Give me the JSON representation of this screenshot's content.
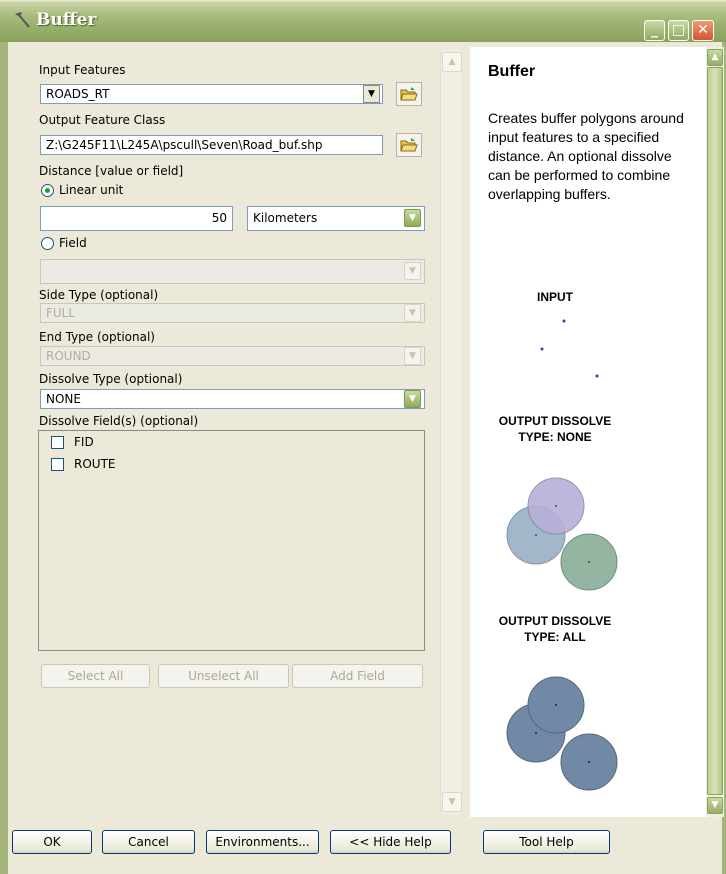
{
  "window": {
    "title": "Buffer",
    "icon": "hammer-icon",
    "controls": [
      "minimize",
      "maximize",
      "close"
    ],
    "accent_color": "#97ad6a"
  },
  "form": {
    "input_features": {
      "label": "Input Features",
      "value": "ROADS_RT"
    },
    "output_feature_class": {
      "label": "Output Feature Class",
      "value": "Z:\\G245F11\\L245A\\pscull\\Seven\\Road_buf.shp"
    },
    "distance": {
      "label": "Distance [value or field]",
      "linear_unit_label": "Linear unit",
      "value": "50",
      "unit": "Kilometers",
      "field_label": "Field",
      "field_value": "",
      "selected": "linear_unit"
    },
    "side_type": {
      "label": "Side Type (optional)",
      "value": "FULL"
    },
    "end_type": {
      "label": "End Type (optional)",
      "value": "ROUND"
    },
    "dissolve_type": {
      "label": "Dissolve Type (optional)",
      "value": "NONE"
    },
    "dissolve_fields": {
      "label": "Dissolve Field(s) (optional)",
      "items": [
        {
          "label": "FID",
          "checked": false
        },
        {
          "label": "ROUTE",
          "checked": false
        }
      ]
    },
    "list_buttons": {
      "select_all": "Select All",
      "unselect_all": "Unselect All",
      "add_field": "Add Field"
    }
  },
  "help": {
    "title": "Buffer",
    "description": "Creates buffer polygons around input features to a specified distance. An optional dissolve can be performed to combine overlapping buffers.",
    "input_caption": "INPUT",
    "output_none_caption": "OUTPUT DISSOLVE TYPE: NONE",
    "output_all_caption": "OUTPUT DISSOLVE TYPE: ALL",
    "colors": {
      "purple": "#b8b0d8",
      "blue": "#9fb4c9",
      "green": "#8fb29e",
      "dissolved": "#6f89a6"
    }
  },
  "buttons": {
    "ok": "OK",
    "cancel": "Cancel",
    "environments": "Environments...",
    "hide_help": "<< Hide Help",
    "tool_help": "Tool Help"
  }
}
